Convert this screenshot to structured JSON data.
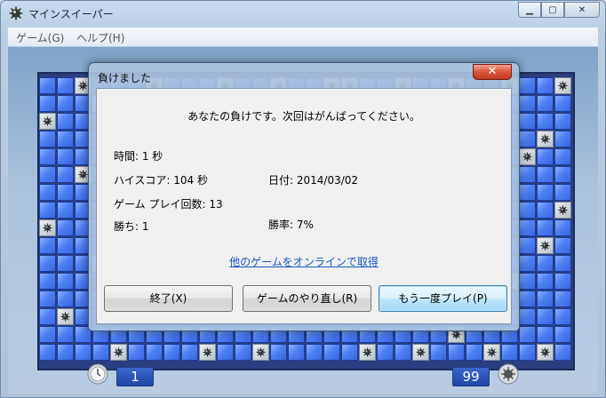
{
  "window": {
    "title": "マインスイーパー",
    "caption_min": "▁",
    "caption_max": "▢",
    "caption_close": "✕"
  },
  "menu": {
    "items": [
      "ゲーム(G)",
      "ヘルプ(H)"
    ]
  },
  "status": {
    "timer_value": "1",
    "mines_remaining": "99"
  },
  "dialog": {
    "title": "負けました",
    "close_glyph": "✕",
    "message": "あなたの負けです。次回はがんばってください。",
    "time": "時間: 1 秒",
    "high_score": "ハイスコア: 104 秒",
    "date": "日付: 2014/03/02",
    "games_played": "ゲーム プレイ回数: 13",
    "wins": "勝ち: 1",
    "win_rate": "勝率: 7%",
    "online_link": "他のゲームをオンラインで取得",
    "buttons": {
      "exit": "終了(X)",
      "restart": "ゲームのやり直し(R)",
      "play_again": "もう一度プレイ(P)"
    }
  },
  "colors": {
    "tile_blue": "#4f7ff2",
    "link": "#1b56c5",
    "close_red": "#d8553c"
  }
}
